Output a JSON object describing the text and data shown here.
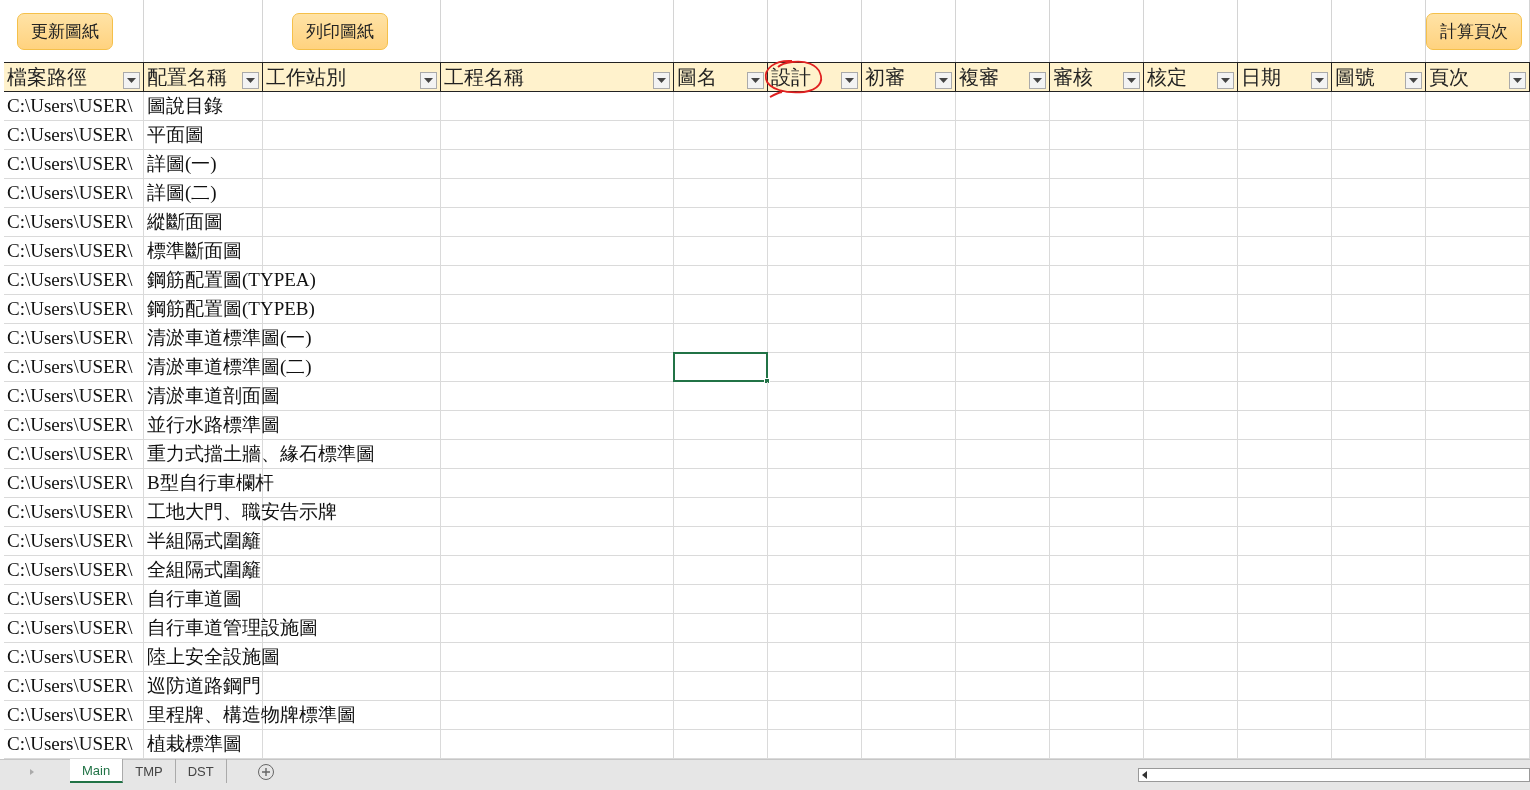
{
  "toolbar_buttons": [
    {
      "label": "更新圖紙"
    },
    {
      "label": "列印圖紙"
    },
    {
      "label": "計算頁次"
    }
  ],
  "columns": [
    {
      "label": "檔案路徑",
      "circled": false
    },
    {
      "label": "配置名稱",
      "circled": false
    },
    {
      "label": "工作站別",
      "circled": false
    },
    {
      "label": "工程名稱",
      "circled": false
    },
    {
      "label": "圖名",
      "circled": false
    },
    {
      "label": "設計",
      "circled": true
    },
    {
      "label": "初審",
      "circled": false
    },
    {
      "label": "複審",
      "circled": false
    },
    {
      "label": "審核",
      "circled": false
    },
    {
      "label": "核定",
      "circled": false
    },
    {
      "label": "日期",
      "circled": false
    },
    {
      "label": "圖號",
      "circled": false
    },
    {
      "label": "頁次",
      "circled": false
    }
  ],
  "rows": [
    {
      "path": "C:\\Users\\USER\\",
      "name": "圖說目錄",
      "selected": false
    },
    {
      "path": "C:\\Users\\USER\\",
      "name": "平面圖",
      "selected": false
    },
    {
      "path": "C:\\Users\\USER\\",
      "name": "詳圖(一)",
      "selected": false
    },
    {
      "path": "C:\\Users\\USER\\",
      "name": "詳圖(二)",
      "selected": false
    },
    {
      "path": "C:\\Users\\USER\\",
      "name": "縱斷面圖",
      "selected": false
    },
    {
      "path": "C:\\Users\\USER\\",
      "name": "標準斷面圖",
      "selected": false
    },
    {
      "path": "C:\\Users\\USER\\",
      "name": "鋼筋配置圖(TYPEA)",
      "selected": false
    },
    {
      "path": "C:\\Users\\USER\\",
      "name": "鋼筋配置圖(TYPEB)",
      "selected": false
    },
    {
      "path": "C:\\Users\\USER\\",
      "name": "清淤車道標準圖(一)",
      "selected": false
    },
    {
      "path": "C:\\Users\\USER\\",
      "name": "清淤車道標準圖(二)",
      "selected": true
    },
    {
      "path": "C:\\Users\\USER\\",
      "name": "清淤車道剖面圖",
      "selected": false
    },
    {
      "path": "C:\\Users\\USER\\",
      "name": "並行水路標準圖",
      "selected": false
    },
    {
      "path": "C:\\Users\\USER\\",
      "name": "重力式擋土牆、緣石標準圖",
      "selected": false
    },
    {
      "path": "C:\\Users\\USER\\",
      "name": "B型自行車欄杆",
      "selected": false
    },
    {
      "path": "C:\\Users\\USER\\",
      "name": "工地大門、職安告示牌",
      "selected": false
    },
    {
      "path": "C:\\Users\\USER\\",
      "name": "半組隔式圍籬",
      "selected": false
    },
    {
      "path": "C:\\Users\\USER\\",
      "name": "全組隔式圍籬",
      "selected": false
    },
    {
      "path": "C:\\Users\\USER\\",
      "name": "自行車道圖",
      "selected": false
    },
    {
      "path": "C:\\Users\\USER\\",
      "name": "自行車道管理設施圖",
      "selected": false
    },
    {
      "path": "C:\\Users\\USER\\",
      "name": "陸上安全設施圖",
      "selected": false
    },
    {
      "path": "C:\\Users\\USER\\",
      "name": "巡防道路鋼門",
      "selected": false
    },
    {
      "path": "C:\\Users\\USER\\",
      "name": "里程牌、構造物牌標準圖",
      "selected": false
    },
    {
      "path": "C:\\Users\\USER\\",
      "name": "植栽標準圖",
      "selected": false
    }
  ],
  "sheet_tabs": [
    {
      "label": "Main",
      "selected": true
    },
    {
      "label": "TMP",
      "selected": false
    },
    {
      "label": "DST",
      "selected": false
    }
  ]
}
